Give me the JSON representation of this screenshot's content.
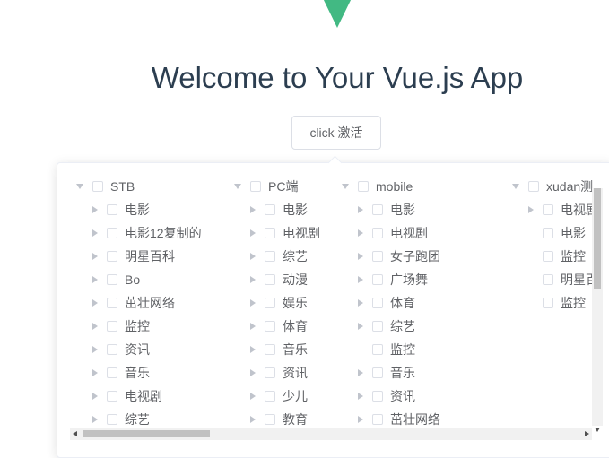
{
  "app": {
    "title": "Welcome to Your Vue.js App",
    "logo_color": "#42b983",
    "button_label": "click 激活"
  },
  "tree": {
    "columns": [
      {
        "root": "STB",
        "children": [
          {
            "label": "电影",
            "expandable": true
          },
          {
            "label": "电影12复制的",
            "expandable": true
          },
          {
            "label": "明星百科",
            "expandable": true
          },
          {
            "label": "Bo",
            "expandable": true
          },
          {
            "label": "茁壮网络",
            "expandable": true
          },
          {
            "label": "监控",
            "expandable": true
          },
          {
            "label": "资讯",
            "expandable": true
          },
          {
            "label": "音乐",
            "expandable": true
          },
          {
            "label": "电视剧",
            "expandable": true
          },
          {
            "label": "综艺",
            "expandable": true
          }
        ]
      },
      {
        "root": "PC端",
        "children": [
          {
            "label": "电影",
            "expandable": true
          },
          {
            "label": "电视剧",
            "expandable": true
          },
          {
            "label": "综艺",
            "expandable": true
          },
          {
            "label": "动漫",
            "expandable": true
          },
          {
            "label": "娱乐",
            "expandable": true
          },
          {
            "label": "体育",
            "expandable": true
          },
          {
            "label": "音乐",
            "expandable": true
          },
          {
            "label": "资讯",
            "expandable": true
          },
          {
            "label": "少儿",
            "expandable": true
          },
          {
            "label": "教育",
            "expandable": true
          }
        ]
      },
      {
        "root": "mobile",
        "children": [
          {
            "label": "电影",
            "expandable": true
          },
          {
            "label": "电视剧",
            "expandable": true
          },
          {
            "label": "女子跑团",
            "expandable": true
          },
          {
            "label": "广场舞",
            "expandable": true
          },
          {
            "label": "体育",
            "expandable": true
          },
          {
            "label": "综艺",
            "expandable": true
          },
          {
            "label": "监控",
            "expandable": false
          },
          {
            "label": "音乐",
            "expandable": true
          },
          {
            "label": "资讯",
            "expandable": true
          },
          {
            "label": "茁壮网络",
            "expandable": true
          }
        ]
      },
      {
        "root": "xudan测",
        "children": [
          {
            "label": "电视剧",
            "expandable": true
          },
          {
            "label": "电影",
            "expandable": false
          },
          {
            "label": "监控",
            "expandable": false
          },
          {
            "label": "明星百",
            "expandable": false
          },
          {
            "label": "监控",
            "expandable": false
          }
        ]
      }
    ]
  }
}
